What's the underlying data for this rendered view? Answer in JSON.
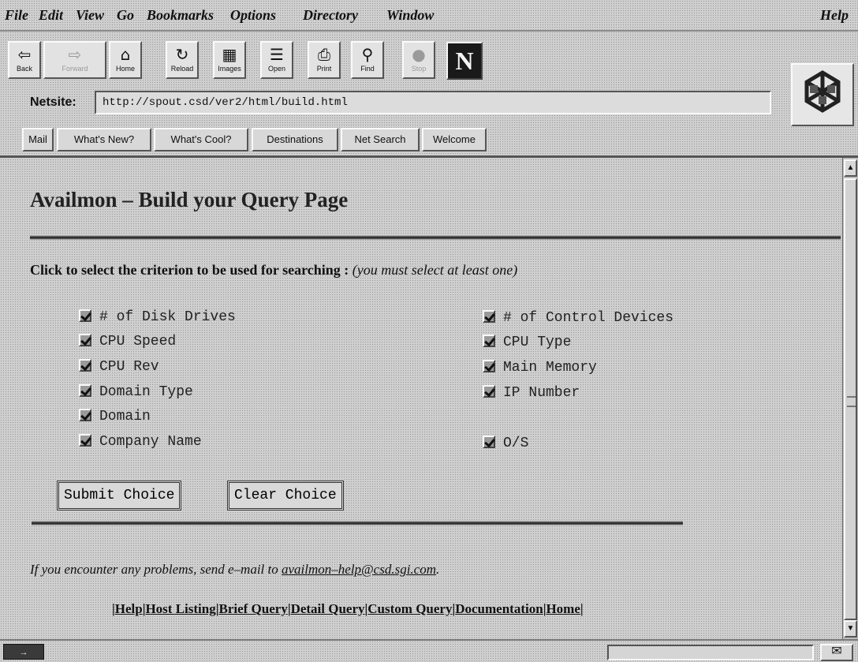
{
  "menubar": {
    "items": [
      "File",
      "Edit",
      "View",
      "Go",
      "Bookmarks",
      "Options",
      "Directory",
      "Window"
    ],
    "help": "Help"
  },
  "toolbar": {
    "buttons": [
      {
        "label": "Back",
        "icon": "back-arrow-icon",
        "glyph": "⇦"
      },
      {
        "label": "Forward",
        "icon": "forward-arrow-icon",
        "glyph": "⇨"
      },
      {
        "label": "Home",
        "icon": "home-icon",
        "glyph": "⌂"
      },
      {
        "label": "Reload",
        "icon": "reload-icon",
        "glyph": "↻"
      },
      {
        "label": "Images",
        "icon": "images-icon",
        "glyph": "▦"
      },
      {
        "label": "Open",
        "icon": "open-icon",
        "glyph": "☰"
      },
      {
        "label": "Print",
        "icon": "print-icon",
        "glyph": "⎙"
      },
      {
        "label": "Find",
        "icon": "find-icon",
        "glyph": "⚲"
      },
      {
        "label": "Stop",
        "icon": "stop-icon",
        "glyph": "●"
      }
    ],
    "logo": "N"
  },
  "location": {
    "label": "Netsite:",
    "url": "http://spout.csd/ver2/html/build.html"
  },
  "directory_buttons": [
    "Mail",
    "What's New?",
    "What's Cool?",
    "Destinations",
    "Net Search",
    "Welcome"
  ],
  "page": {
    "title": "Availmon – Build your Query Page",
    "instruction_bold": "Click to select the criterion to be used for searching :",
    "instruction_italic": "(you must select at least one)",
    "criteria_left": [
      "# of Disk Drives",
      "CPU Speed",
      "CPU Rev",
      "Domain Type",
      "Domain",
      "Company Name"
    ],
    "criteria_right": [
      "# of Control Devices",
      "CPU Type",
      "Main Memory",
      "IP Number",
      "O/S"
    ],
    "submit_label": "Submit Choice",
    "clear_label": "Clear Choice",
    "problem_text": "If you encounter any problems, send e–mail to ",
    "problem_email": "availmon–help@csd.sgi.com",
    "problem_end": ".",
    "footer_links": [
      "Help",
      "Host Listing",
      "Brief Query",
      "Detail Query",
      "Custom Query",
      "Documentation",
      "Home"
    ]
  },
  "statusbar": {
    "icon_text": "→",
    "mail_glyph": "✉"
  }
}
